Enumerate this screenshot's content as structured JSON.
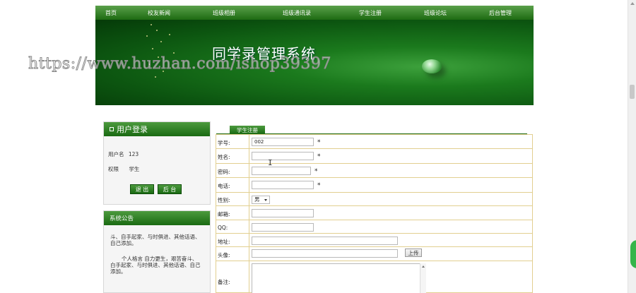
{
  "nav": {
    "items": [
      "首页",
      "校友新闻",
      "班级相册",
      "班级通讯录",
      "学生注册",
      "班级论坛",
      "后台管理"
    ]
  },
  "banner": {
    "title": "同学录管理系统"
  },
  "watermark": "https://www.huzhan.com/ishop39397",
  "login": {
    "title": "用户登录",
    "username_label": "用户名",
    "username_value": "123",
    "role_label": "权限",
    "role_value": "学生",
    "logout_label": "退 出",
    "admin_label": "后 台"
  },
  "notice": {
    "title": "系统公告",
    "paragraphs": [
      "斗、自手起家、与时俱进、其他话语、自己添加。",
      "个人格言 自力更生，艰苦奋斗、白手起家、与时俱进、其他话语、自己添加。"
    ]
  },
  "register": {
    "tab_label": "学生注册",
    "fields": {
      "student_id": {
        "label": "学号:",
        "value": "002",
        "required": "*"
      },
      "name": {
        "label": "姓名:",
        "value": "",
        "required": "*"
      },
      "password": {
        "label": "密码:",
        "value": "",
        "required": "*"
      },
      "phone": {
        "label": "电话:",
        "value": "",
        "required": "*"
      },
      "gender": {
        "label": "性别:",
        "value": "男"
      },
      "email": {
        "label": "邮箱:",
        "value": ""
      },
      "qq": {
        "label": "QQ:",
        "value": ""
      },
      "address": {
        "label": "地址:",
        "value": ""
      },
      "avatar": {
        "label": "头像:",
        "value": "",
        "upload_label": "上传"
      },
      "remarks": {
        "label": "备注:",
        "value": ""
      }
    }
  },
  "colors": {
    "nav_green": "#1d6b12",
    "banner_green": "#0c5510",
    "form_border": "#e2cf90",
    "chat_widget": "#35b54a"
  }
}
